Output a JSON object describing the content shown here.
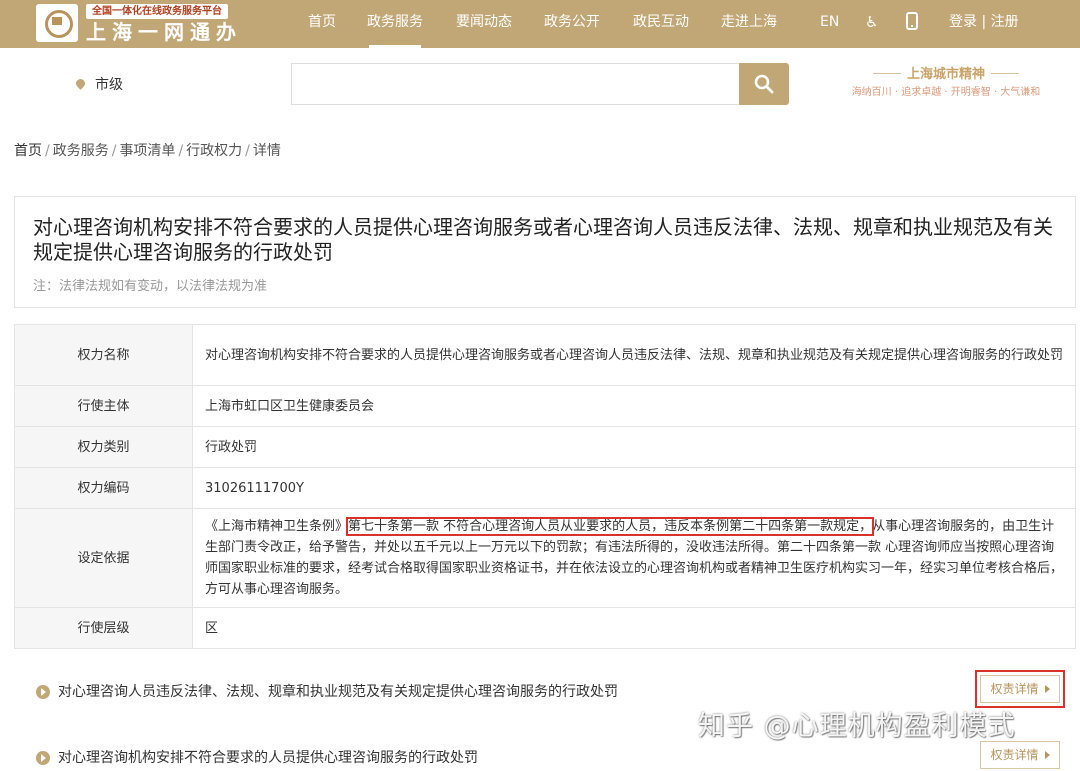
{
  "header": {
    "platform_badge": "全国一体化在线政务服务平台",
    "site_name": "上海一网通办",
    "nav": [
      "首页",
      "政务服务",
      "要闻动态",
      "政务公开",
      "政民互动",
      "走进上海",
      "EN"
    ],
    "active_nav": "政务服务",
    "login": "登录 | 注册"
  },
  "search": {
    "location": "市级",
    "placeholder": "",
    "spirit_title": "上海城市精神",
    "spirit_motto": "海纳百川 · 追求卓越 · 开明睿智 · 大气谦和"
  },
  "breadcrumb": [
    "首页",
    "政务服务",
    "事项清单",
    "行政权力",
    "详情"
  ],
  "page": {
    "title": "对心理咨询机构安排不符合要求的人员提供心理咨询服务或者心理咨询人员违反法律、法规、规章和执业规范及有关规定提供心理咨询服务的行政处罚",
    "note": "注：法律法规如有变动，以法律法规为准"
  },
  "details": {
    "name_label": "权力名称",
    "name_value": "对心理咨询机构安排不符合要求的人员提供心理咨询服务或者心理咨询人员违反法律、法规、规章和执业规范及有关规定提供心理咨询服务的行政处罚",
    "subject_label": "行使主体",
    "subject_value": "上海市虹口区卫生健康委员会",
    "category_label": "权力类别",
    "category_value": "行政处罚",
    "code_label": "权力编码",
    "code_value": "31026111700Y",
    "basis_label": "设定依据",
    "basis_prefix": "《上海市精神卫生条例》",
    "basis_highlight": "第七十条第一款 不符合心理咨询人员从业要求的人员，违反本条例第二十四条第一款规定，",
    "basis_rest": "从事心理咨询服务的，由卫生计生部门责令改正，给予警告，并处以五千元以上一万元以下的罚款；有违法所得的，没收违法所得。第二十四条第一款 心理咨询师应当按照心理咨询师国家职业标准的要求，经考试合格取得国家职业资格证书，并在依法设立的心理咨询机构或者精神卫生医疗机构实习一年，经实习单位考核合格后，方可从事心理咨询服务。",
    "level_label": "行使层级",
    "level_value": "区"
  },
  "related": [
    {
      "text": "对心理咨询人员违反法律、法规、规章和执业规范及有关规定提供心理咨询服务的行政处罚",
      "button": "权责详情"
    },
    {
      "text": "对心理咨询机构安排不符合要求的人员提供心理咨询服务的行政处罚",
      "button": "权责详情"
    }
  ],
  "watermark": "知乎 @心理机构盈利模式"
}
